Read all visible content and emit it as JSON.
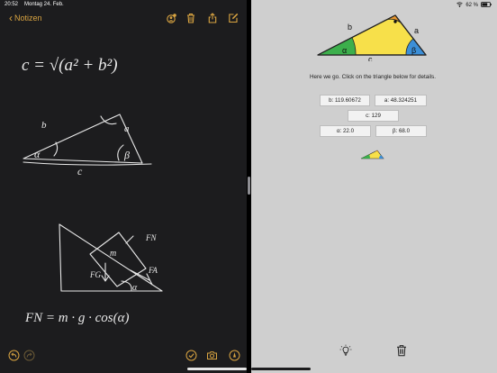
{
  "status_bar": {
    "time": "20:52",
    "date": "Montag 24. Feb.",
    "battery": "62 %"
  },
  "notes": {
    "back_label": "Notizen",
    "accent_color": "#d9a441",
    "toolbar_icons": [
      "share-collab-icon",
      "trash-icon",
      "share-icon",
      "compose-icon"
    ],
    "bottom_icons": [
      "undo-icon",
      "redo-icon",
      "checklist-icon",
      "camera-icon",
      "markup-icon"
    ],
    "drawing": {
      "formula_1": "c = √(a² + b²)",
      "triangle_labels": {
        "b": "b",
        "a": "a",
        "alpha": "α",
        "beta": "β",
        "c": "c"
      },
      "incline_labels": {
        "fn": "FN",
        "m": "m",
        "fg": "FG",
        "fa": "FA",
        "alpha": "α"
      },
      "formula_2": "FN = m · g · cos(α)"
    }
  },
  "calculator": {
    "triangle_labels": {
      "b": "b",
      "a": "a",
      "c": "c",
      "alpha": "α",
      "beta": "β"
    },
    "colors": {
      "fill": "#f7e04a",
      "alpha": "#3caf4c",
      "beta": "#3c8fd8",
      "right_angle": "#e8962e"
    },
    "info_text": "Here we go. Click on the triangle below for details.",
    "values": {
      "b": "b: 119.60672",
      "a": "a: 48.324251",
      "c": "c: 129",
      "alpha": "α: 22.0",
      "beta": "β: 68.0"
    },
    "bottom_icons": [
      "lightbulb-icon",
      "trash-icon"
    ]
  }
}
